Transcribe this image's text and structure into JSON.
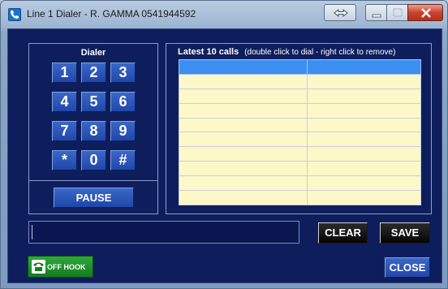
{
  "window": {
    "title": "Line 1 Dialer - R. GAMMA 0541944592",
    "accent_color": "#0e1e5c"
  },
  "dialer": {
    "title": "Dialer",
    "keys": [
      "1",
      "2",
      "3",
      "4",
      "5",
      "6",
      "7",
      "8",
      "9",
      "*",
      "0",
      "#"
    ],
    "pause_label": "PAUSE"
  },
  "calls": {
    "title": "Latest 10 calls",
    "hint": "(double click to dial - right click to remove)",
    "rows": 10
  },
  "number_display": {
    "value": ""
  },
  "buttons": {
    "clear": "CLEAR",
    "save": "SAVE",
    "close": "CLOSE",
    "hook": "OFF HOOK"
  },
  "icons": {
    "app": "phone-app-icon",
    "hook": "telephone-icon"
  }
}
